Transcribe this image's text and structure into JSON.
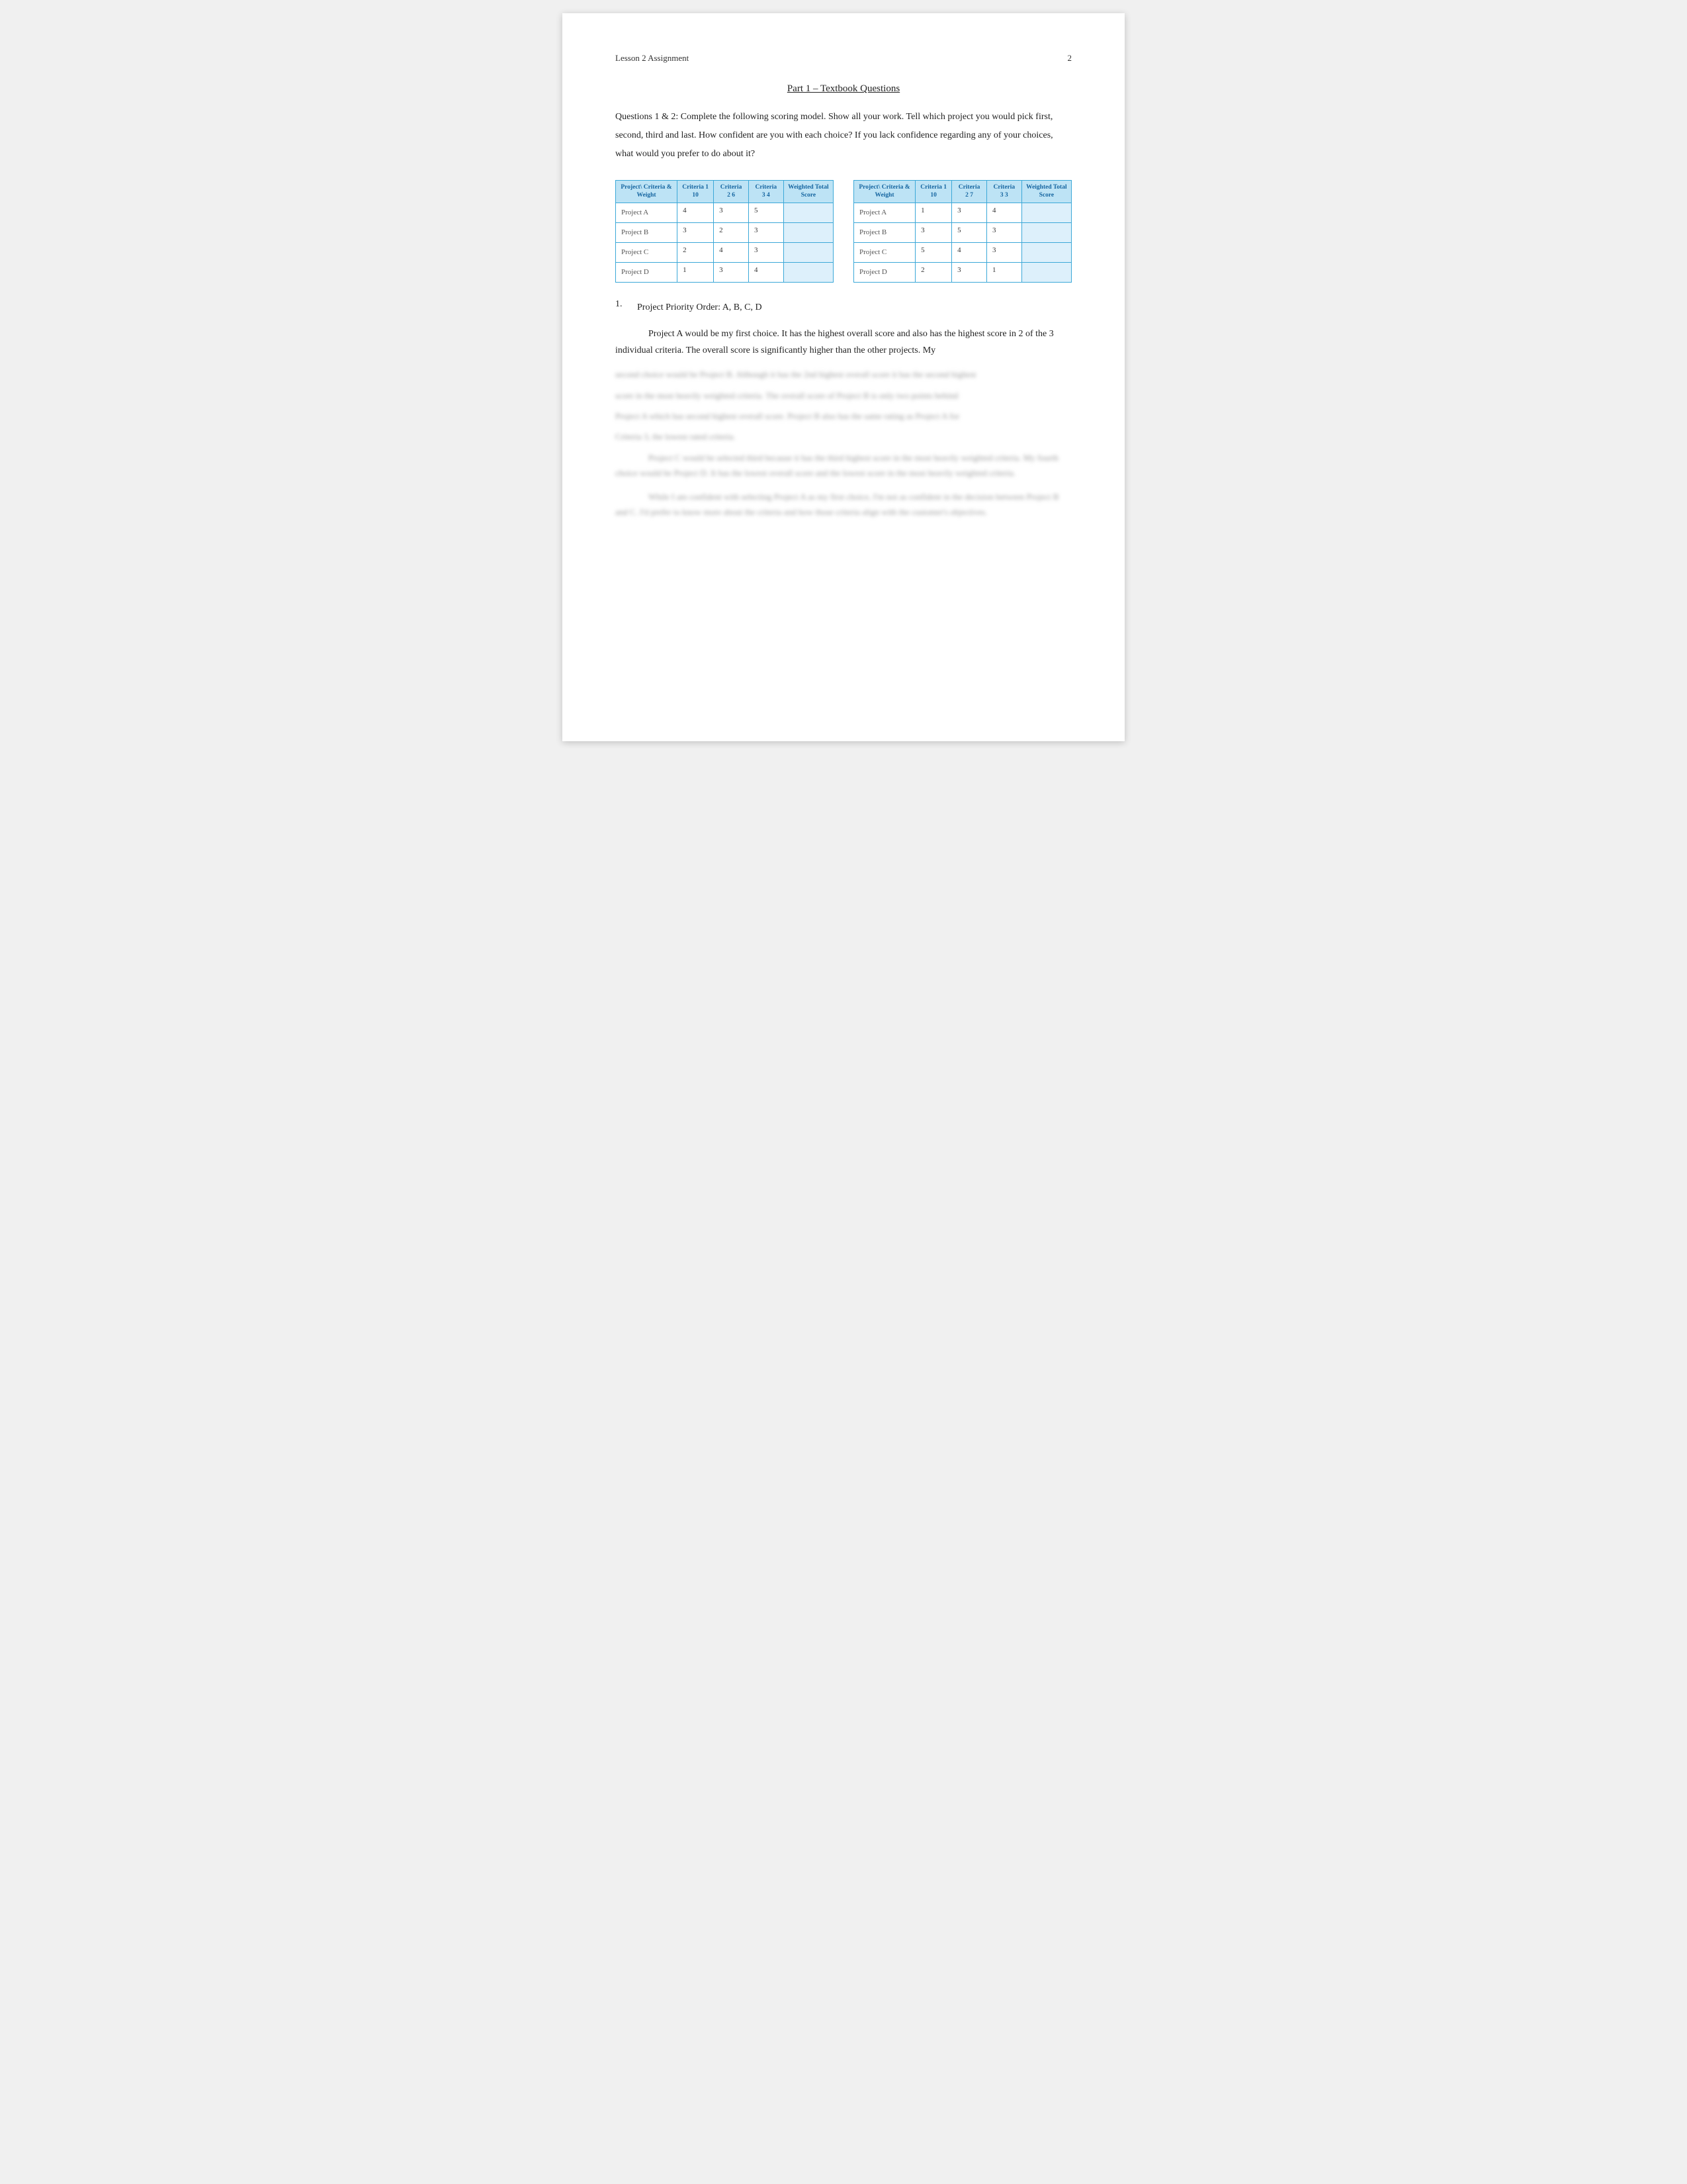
{
  "header": {
    "title": "Lesson 2 Assignment",
    "page_number": "2"
  },
  "section_title": "Part 1 – Textbook Questions",
  "intro_text": "Questions 1 & 2: Complete the following scoring model. Show all your work. Tell which project you would pick first, second, third and last. How confident are you with each choice? If you lack confidence regarding any of your choices, what would you prefer to do about it?",
  "table1": {
    "headers": [
      "Project\\ Criteria & Weight",
      "Criteria 1 10",
      "Criteria 2 6",
      "Criteria 3 4",
      "Weighted Total Score"
    ],
    "rows": [
      {
        "project": "Project A",
        "c1": "4",
        "c2": "3",
        "c3": "5",
        "weighted": ""
      },
      {
        "project": "Project B",
        "c1": "3",
        "c2": "2",
        "c3": "3",
        "weighted": ""
      },
      {
        "project": "Project C",
        "c1": "2",
        "c2": "4",
        "c3": "3",
        "weighted": ""
      },
      {
        "project": "Project D",
        "c1": "1",
        "c2": "3",
        "c3": "4",
        "weighted": ""
      }
    ]
  },
  "table2": {
    "headers": [
      "Project\\ Criteria & Weight",
      "Criteria 1 10",
      "Criteria 2 7",
      "Criteria 3 3",
      "Weighted Total Score"
    ],
    "rows": [
      {
        "project": "Project A",
        "c1": "1",
        "c2": "3",
        "c3": "4",
        "weighted": ""
      },
      {
        "project": "Project B",
        "c1": "3",
        "c2": "5",
        "c3": "3",
        "weighted": ""
      },
      {
        "project": "Project C",
        "c1": "5",
        "c2": "4",
        "c3": "3",
        "weighted": ""
      },
      {
        "project": "Project D",
        "c1": "2",
        "c2": "3",
        "c3": "1",
        "weighted": ""
      }
    ]
  },
  "answer1": {
    "number": "1.",
    "label": "Project Priority Order: A, B, C, D"
  },
  "paragraph1": "Project A would be my first choice. It has the highest overall score and also has the highest score in 2 of the 3 individual criteria. The overall score is significantly higher than the other projects. My",
  "blurred_lines": [
    "second choice would be Project B. Although it has the 2nd highest overall score it has the second highest",
    "score in the most heavily weighted criteria. The overall score of Project B is only two points behind",
    "Project A which has second highest overall score. Project B also has the same rating as Project A for",
    "Criteria 3, the lowest rated criteria."
  ],
  "blurred_paragraph2": "Project C would be selected third because it has the third highest score in the most heavily weighted criteria. My fourth choice would be Project D. It has the lowest overall score and the lowest score in the most heavily weighted criteria.",
  "blurred_paragraph3": "While I am confident with selecting Project A as my first choice, I'm not as confident in the decision between Project B and C. I'd prefer to know more about the criteria and how those criteria align with the customer's objectives."
}
